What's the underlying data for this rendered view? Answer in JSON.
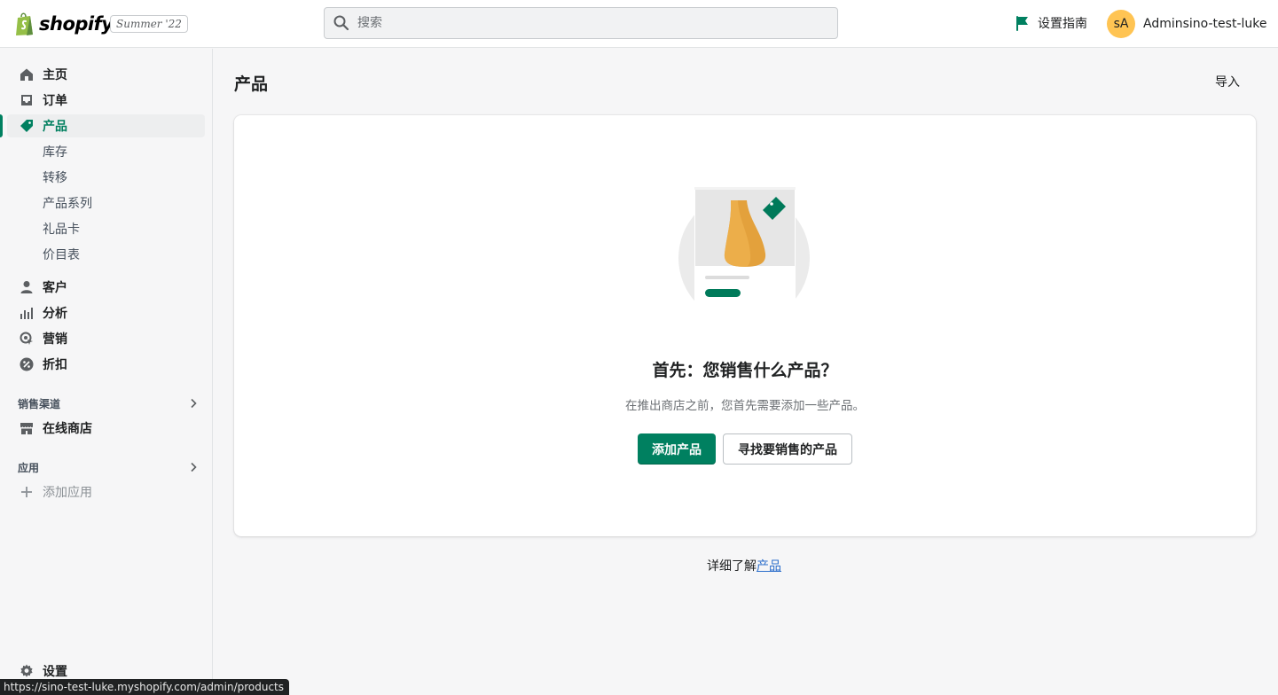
{
  "topbar": {
    "brand": "shopify",
    "edition_badge": "Summer '22",
    "search_placeholder": "搜索",
    "setup_guide_label": "设置指南",
    "avatar_initials": "sA",
    "account_name": "Adminsino-test-luke"
  },
  "sidebar": {
    "primary": [
      {
        "label": "主页",
        "icon": "home-icon"
      },
      {
        "label": "订单",
        "icon": "orders-icon"
      },
      {
        "label": "产品",
        "icon": "tag-icon",
        "active": true
      }
    ],
    "product_sub": [
      "库存",
      "转移",
      "产品系列",
      "礼品卡",
      "价目表"
    ],
    "secondary": [
      {
        "label": "客户",
        "icon": "customer-icon"
      },
      {
        "label": "分析",
        "icon": "analytics-icon"
      },
      {
        "label": "营销",
        "icon": "marketing-icon"
      },
      {
        "label": "折扣",
        "icon": "discount-icon"
      }
    ],
    "sales_channels_heading": "销售渠道",
    "online_store": "在线商店",
    "apps_heading": "应用",
    "add_app": "添加应用",
    "settings": "设置"
  },
  "main": {
    "page_title": "产品",
    "import_label": "导入",
    "empty_heading": "首先：您销售什么产品？",
    "empty_subtext": "在推出商店之前，您首先需要添加一些产品。",
    "primary_action": "添加产品",
    "secondary_action": "寻找要销售的产品",
    "learn_more_prefix": "详细了解",
    "learn_more_link": "产品"
  },
  "status_bar_url": "https://sino-test-luke.myshopify.com/admin/products",
  "colors": {
    "brand_green": "#008060",
    "active_text": "#007f5f",
    "avatar_bg": "#ffc453",
    "link": "#2c6ecb"
  }
}
